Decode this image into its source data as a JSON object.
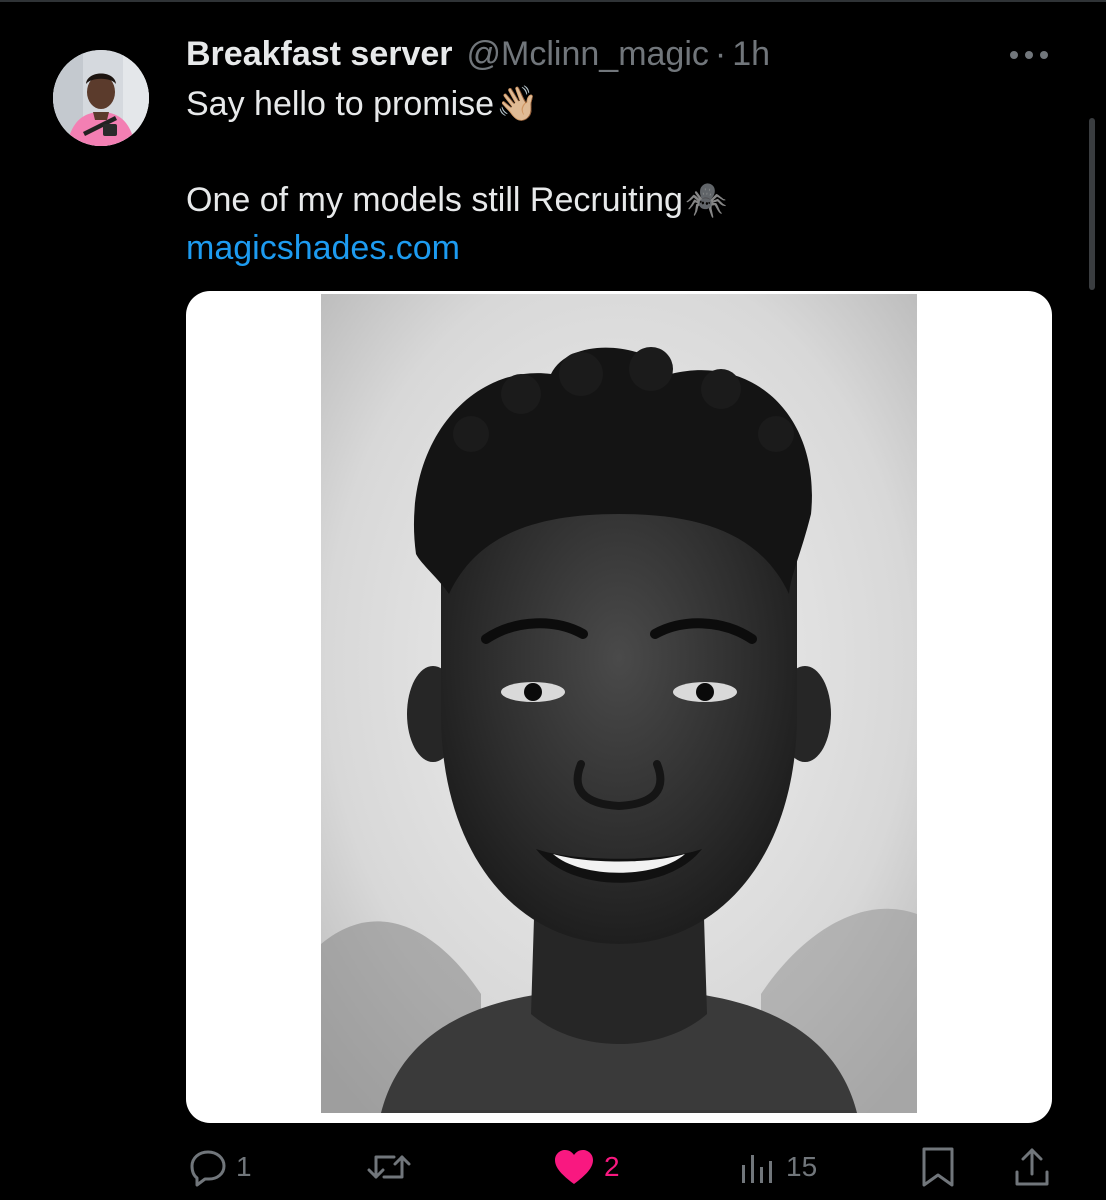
{
  "tweet": {
    "display_name": "Breakfast server",
    "handle": "@Mclinn_magic",
    "separator": "·",
    "time": "1h",
    "line1": "Say hello to promise",
    "line1_emoji": "👋🏼",
    "line2": "One of my models still Recruiting",
    "line2_emoji": "🕷️",
    "link": "magicshades.com"
  },
  "actions": {
    "replies": "1",
    "reposts": "",
    "likes": "2",
    "views": "15"
  },
  "icons": {
    "more": "more-horizontal-icon",
    "reply": "reply-icon",
    "repost": "repost-icon",
    "like": "heart-filled-icon",
    "views": "views-chart-icon",
    "bookmark": "bookmark-icon",
    "share": "share-icon"
  },
  "colors": {
    "background": "#000000",
    "primary_text": "#e7e9ea",
    "secondary_text": "#71767b",
    "link": "#1d9bf0",
    "like_active": "#f91880"
  }
}
